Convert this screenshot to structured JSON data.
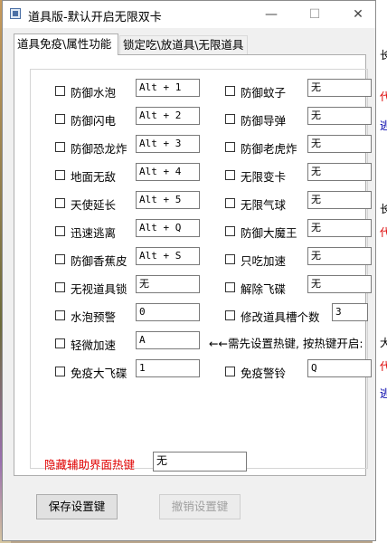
{
  "window": {
    "title": "道具版-默认开启无限双卡"
  },
  "titlebar_buttons": {
    "minimize": "—",
    "maximize": "☐",
    "close": "✕"
  },
  "tabs": [
    {
      "label": "道具免疫\\属性功能"
    },
    {
      "label": "锁定吃\\放道具\\无限道具"
    }
  ],
  "options_left": [
    {
      "label": "防御水泡",
      "hotkey": "Alt + 1"
    },
    {
      "label": "防御闪电",
      "hotkey": "Alt + 2"
    },
    {
      "label": "防御恐龙炸",
      "hotkey": "Alt + 3"
    },
    {
      "label": "地面无敌",
      "hotkey": "Alt + 4"
    },
    {
      "label": "天使延长",
      "hotkey": "Alt + 5"
    },
    {
      "label": "迅速逃离",
      "hotkey": "Alt + Q"
    },
    {
      "label": "防御香蕉皮",
      "hotkey": "Alt + S"
    },
    {
      "label": "无视道具锁",
      "hotkey": "无"
    },
    {
      "label": "水泡预警",
      "hotkey": "0"
    },
    {
      "label": "轻微加速",
      "hotkey": "A"
    },
    {
      "label": "免疫大飞碟",
      "hotkey": "1"
    }
  ],
  "options_right": [
    {
      "label": "防御蚊子",
      "hotkey": "无"
    },
    {
      "label": "防御导弹",
      "hotkey": "无"
    },
    {
      "label": "防御老虎炸",
      "hotkey": "无"
    },
    {
      "label": "无限变卡",
      "hotkey": "无"
    },
    {
      "label": "无限气球",
      "hotkey": "无"
    },
    {
      "label": "防御大魔王",
      "hotkey": "无"
    },
    {
      "label": "只吃加速",
      "hotkey": "无"
    },
    {
      "label": "解除飞碟",
      "hotkey": "无"
    },
    {
      "label": "修改道具槽个数",
      "hotkey": "3"
    },
    {
      "label": "免疫警铃",
      "hotkey": "Q"
    }
  ],
  "note": "←←需先设置热键, 按热键开启:",
  "hide_ui": {
    "label": "隐藏辅助界面热键",
    "value": "无"
  },
  "buttons": {
    "save": "保存设置键",
    "cancel": "撤销设置键"
  },
  "background_marks": [
    "长",
    "代",
    "逃",
    "长",
    "代",
    "大",
    "代",
    "逃"
  ]
}
